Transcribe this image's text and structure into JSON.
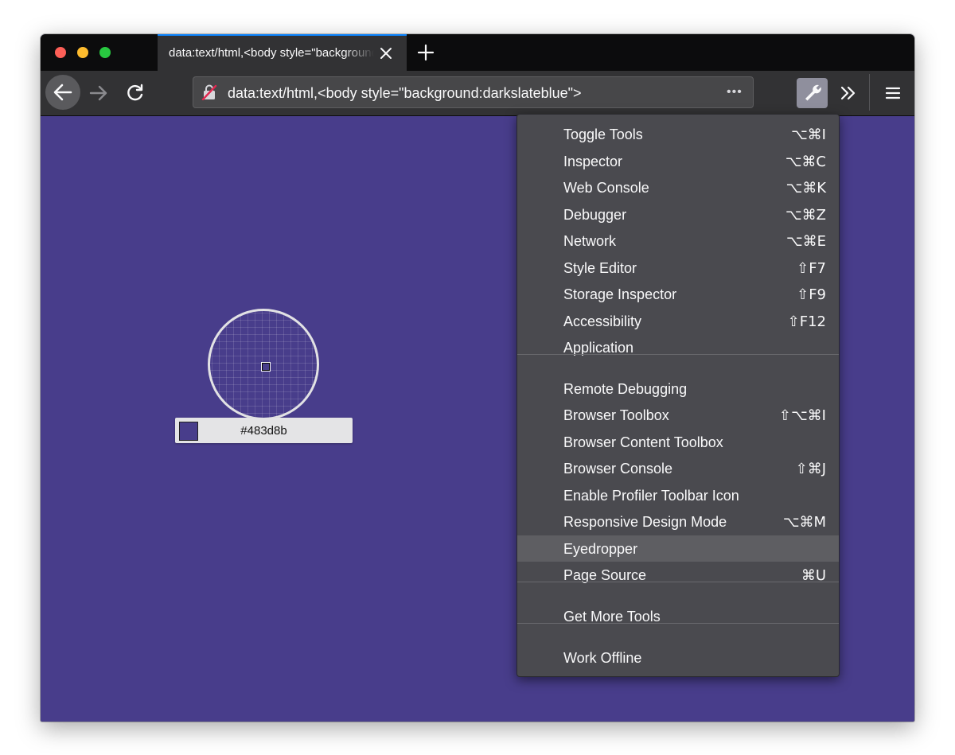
{
  "browser": {
    "tab": {
      "title": "data:text/html,<body style=\"background:darkslateblue\">"
    },
    "url": "data:text/html,<body style=\"background:darkslateblue\">",
    "page_actions_label": "•••"
  },
  "page": {
    "background_color": "#483d8b"
  },
  "eyedropper": {
    "color_value": "#483d8b"
  },
  "devtools_menu": {
    "items": [
      {
        "label": "Toggle Tools",
        "shortcut": "⌥⌘I"
      },
      {
        "label": "Inspector",
        "shortcut": "⌥⌘C"
      },
      {
        "label": "Web Console",
        "shortcut": "⌥⌘K"
      },
      {
        "label": "Debugger",
        "shortcut": "⌥⌘Z"
      },
      {
        "label": "Network",
        "shortcut": "⌥⌘E"
      },
      {
        "label": "Style Editor",
        "shortcut": "⇧F7"
      },
      {
        "label": "Storage Inspector",
        "shortcut": "⇧F9"
      },
      {
        "label": "Accessibility",
        "shortcut": "⇧F12"
      },
      {
        "label": "Application",
        "shortcut": ""
      },
      {
        "label": "Remote Debugging",
        "shortcut": ""
      },
      {
        "label": "Browser Toolbox",
        "shortcut": "⇧⌥⌘I"
      },
      {
        "label": "Browser Content Toolbox",
        "shortcut": ""
      },
      {
        "label": "Browser Console",
        "shortcut": "⇧⌘J"
      },
      {
        "label": "Enable Profiler Toolbar Icon",
        "shortcut": ""
      },
      {
        "label": "Responsive Design Mode",
        "shortcut": "⌥⌘M"
      },
      {
        "label": "Eyedropper",
        "shortcut": ""
      },
      {
        "label": "Page Source",
        "shortcut": "⌘U"
      },
      {
        "label": "Get More Tools",
        "shortcut": ""
      },
      {
        "label": "Work Offline",
        "shortcut": ""
      }
    ]
  }
}
